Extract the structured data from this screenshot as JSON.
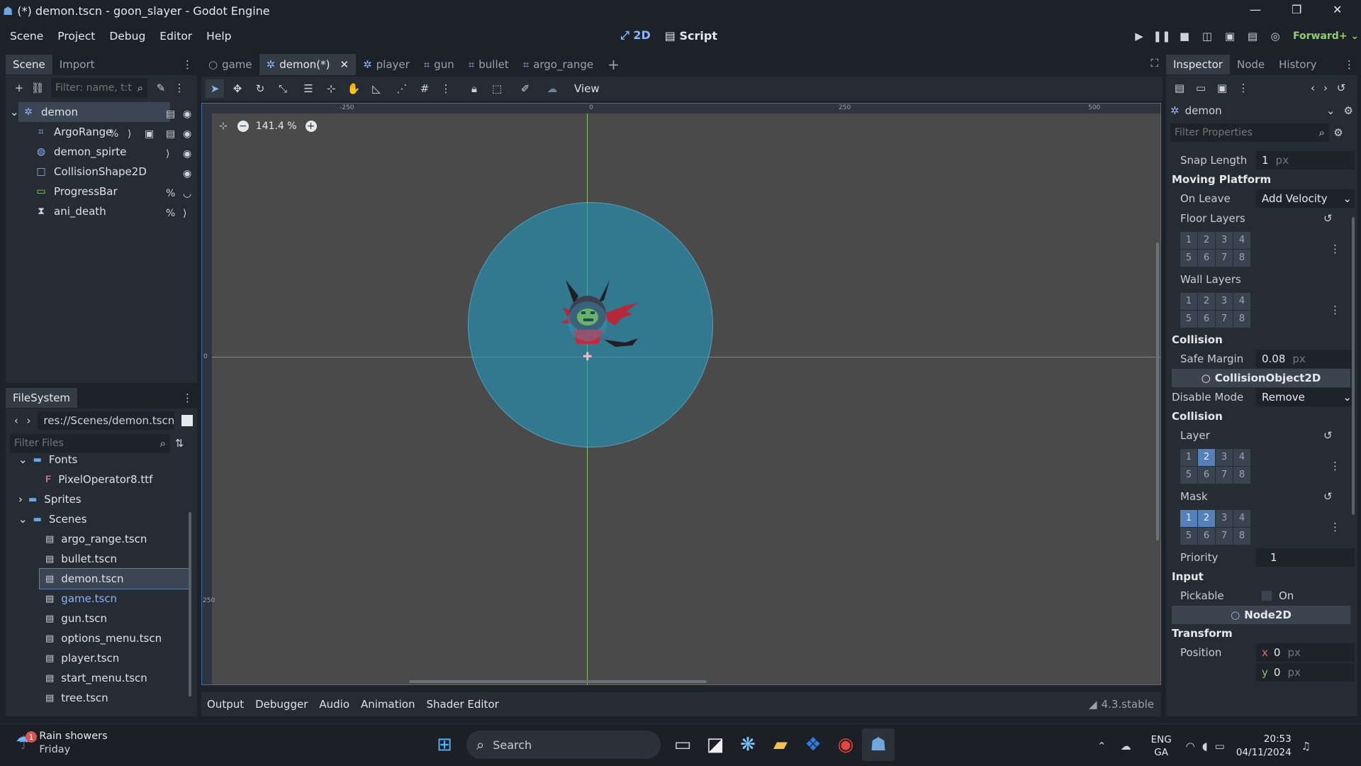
{
  "window": {
    "title": "(*) demon.tscn - goon_slayer - Godot Engine",
    "minimize": "—",
    "maximize": "❐",
    "close": "✕"
  },
  "menu": [
    "Scene",
    "Project",
    "Debug",
    "Editor",
    "Help"
  ],
  "workspace": {
    "two_d": "2D",
    "script": "Script",
    "renderer": "Forward+"
  },
  "scene_dock": {
    "tab_scene": "Scene",
    "tab_import": "Import",
    "filter_placeholder": "Filter: name, t:t",
    "nodes": [
      {
        "name": "demon",
        "icon": "character-body-icon"
      },
      {
        "name": "ArgoRange",
        "icon": "area-icon"
      },
      {
        "name": "demon_spirte",
        "icon": "sprite-icon"
      },
      {
        "name": "CollisionShape2D",
        "icon": "collision-shape-icon"
      },
      {
        "name": "ProgressBar",
        "icon": "progress-bar-icon"
      },
      {
        "name": "ani_death",
        "icon": "animation-player-icon"
      }
    ]
  },
  "filesystem": {
    "title": "FileSystem",
    "path": "res://Scenes/demon.tscn",
    "filter_placeholder": "Filter Files",
    "items": [
      {
        "name": "Fonts",
        "type": "folder",
        "indent": 1
      },
      {
        "name": "PixelOperator8.ttf",
        "type": "font",
        "indent": 2
      },
      {
        "name": "Sprites",
        "type": "folder",
        "indent": 1
      },
      {
        "name": "Scenes",
        "type": "folder",
        "indent": 1
      },
      {
        "name": "argo_range.tscn",
        "type": "scene",
        "indent": 2
      },
      {
        "name": "bullet.tscn",
        "type": "scene",
        "indent": 2
      },
      {
        "name": "demon.tscn",
        "type": "scene",
        "indent": 2,
        "selected": true
      },
      {
        "name": "game.tscn",
        "type": "scene",
        "indent": 2,
        "highlight": true
      },
      {
        "name": "gun.tscn",
        "type": "scene",
        "indent": 2
      },
      {
        "name": "options_menu.tscn",
        "type": "scene",
        "indent": 2
      },
      {
        "name": "player.tscn",
        "type": "scene",
        "indent": 2
      },
      {
        "name": "start_menu.tscn",
        "type": "scene",
        "indent": 2
      },
      {
        "name": "tree.tscn",
        "type": "scene",
        "indent": 2
      }
    ]
  },
  "doc_tabs": [
    "game",
    "demon(*)",
    "player",
    "gun",
    "bullet",
    "argo_range"
  ],
  "viewport": {
    "view_menu": "View",
    "zoom": "141.4 %",
    "ruler_marks": [
      "-250",
      "0",
      "250",
      "500"
    ],
    "ruler_left": [
      "0",
      "250"
    ]
  },
  "bottom": {
    "tabs": [
      "Output",
      "Debugger",
      "Audio",
      "Animation",
      "Shader Editor"
    ],
    "version": "4.3.stable"
  },
  "inspector": {
    "tab_inspector": "Inspector",
    "tab_node": "Node",
    "tab_history": "History",
    "object": "demon",
    "filter_placeholder": "Filter Properties",
    "snap_length_label": "Snap Length",
    "snap_length_value": "1",
    "px": "px",
    "moving_platform": "Moving Platform",
    "on_leave_label": "On Leave",
    "on_leave_value": "Add Velocity",
    "floor_layers": "Floor Layers",
    "wall_layers": "Wall Layers",
    "collision": "Collision",
    "safe_margin_label": "Safe Margin",
    "safe_margin_value": "0.08",
    "collision_object": "CollisionObject2D",
    "disable_mode_label": "Disable Mode",
    "disable_mode_value": "Remove",
    "collision2": "Collision",
    "layer_label": "Layer",
    "mask_label": "Mask",
    "priority_label": "Priority",
    "priority_value": "1",
    "input": "Input",
    "pickable_label": "Pickable",
    "pickable_value": "On",
    "node2d": "Node2D",
    "transform": "Transform",
    "position_label": "Position",
    "pos_x": "0",
    "pos_y": "0",
    "x": "x",
    "y": "y",
    "cells": [
      "1",
      "2",
      "3",
      "4",
      "5",
      "6",
      "7",
      "8"
    ]
  },
  "taskbar": {
    "weather_badge": "1",
    "weather": "Rain showers",
    "day": "Friday",
    "search": "Search",
    "lang1": "ENG",
    "lang2": "GA",
    "time": "20:53",
    "date": "04/11/2024"
  }
}
